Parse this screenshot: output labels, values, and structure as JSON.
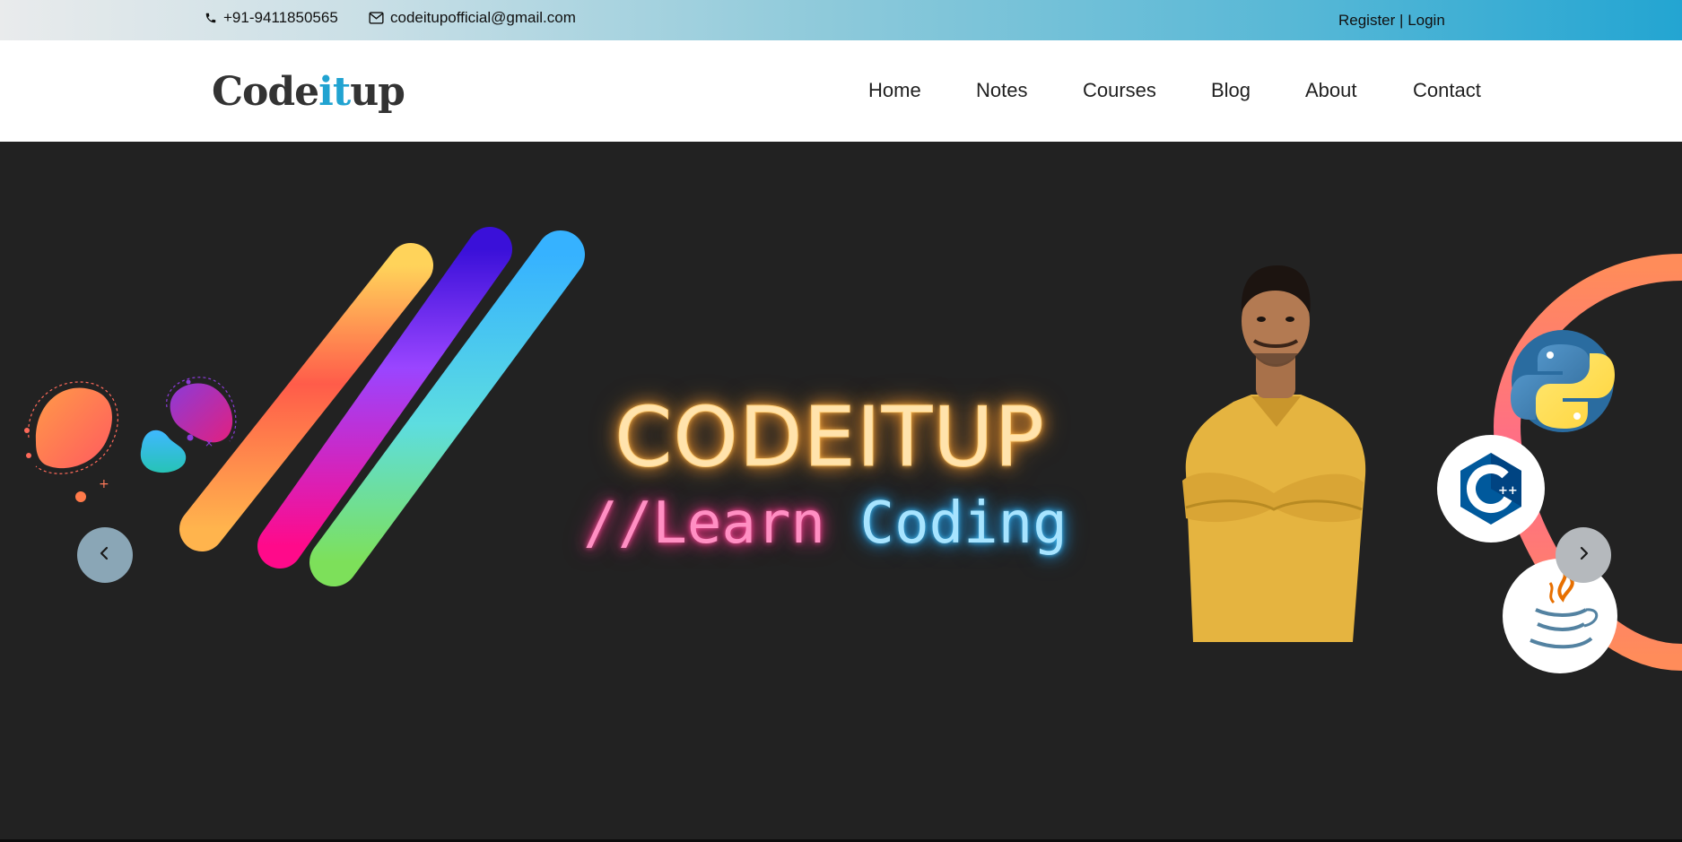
{
  "topbar": {
    "phone": "+91-9411850565",
    "email": "codeitupofficial@gmail.com",
    "register": "Register",
    "separator": " | ",
    "login": "Login",
    "phone_icon": "phone-icon",
    "mail_icon": "envelope-icon"
  },
  "brand": {
    "logo_part1": "Code",
    "logo_part2": "it",
    "logo_part3": "up",
    "accent_color": "#21a3d1"
  },
  "nav": {
    "items": [
      "Home",
      "Notes",
      "Courses",
      "Blog",
      "About",
      "Contact"
    ]
  },
  "hero": {
    "title": "CODEITUP",
    "subtitle_part1": "//Learn",
    "subtitle_part2": " Coding",
    "language_logos": [
      "python-logo",
      "cplusplus-logo",
      "java-logo"
    ],
    "prev_icon": "chevron-left-icon",
    "next_icon": "chevron-right-icon",
    "background_color": "#222222"
  }
}
